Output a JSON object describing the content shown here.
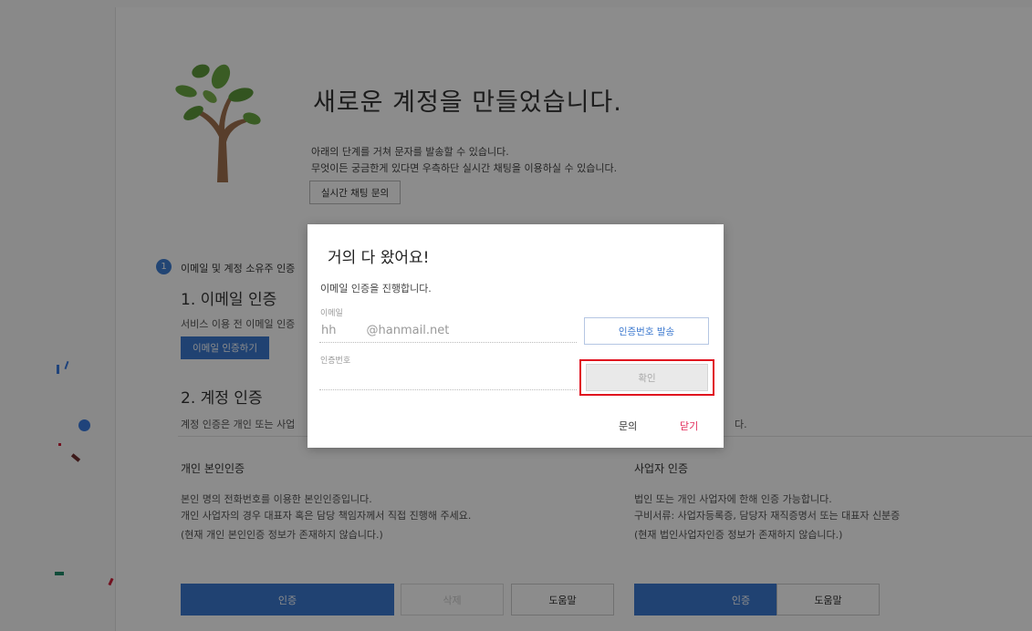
{
  "header": {
    "headline": "새로운 계정을 만들었습니다.",
    "intro_line1": "아래의 단계를 거쳐 문자를 발송할 수 있습니다.",
    "intro_line2": "무엇이든 궁금한게 있다면 우측하단 실시간 채팅을 이용하실 수 있습니다.",
    "chat_button": "실시간 채팅 문의"
  },
  "step": {
    "number": "1",
    "title": "이메일 및 계정 소유주 인증"
  },
  "email_section": {
    "title": "1. 이메일 인증",
    "desc": "서비스 이용 전 이메일 인증",
    "button": "이메일 인증하기"
  },
  "account_section": {
    "title": "2. 계정 인증",
    "desc": "계정 인증은 개인 또는 사업",
    "desc_end": "다."
  },
  "personal": {
    "title": "개인 본인인증",
    "line1": "본인 명의 전화번호를 이용한 본인인증입니다.",
    "line2": "개인 사업자의 경우 대표자 혹은 담당 책임자께서 직접 진행해 주세요.",
    "line3": "(현재 개인 본인인증 정보가 존재하지 않습니다.)",
    "btn_verify": "인증",
    "btn_delete": "삭제",
    "btn_help": "도움말"
  },
  "business": {
    "title": "사업자 인증",
    "line1": "법인 또는 개인 사업자에 한해 인증 가능합니다.",
    "line2": "구비서류: 사업자등록증, 담당자 재직증명서 또는 대표자 신분증",
    "line3": "(현재 법인사업자인증 정보가 존재하지 않습니다.)",
    "btn_verify": "인증",
    "btn_help": "도움말"
  },
  "modal": {
    "title": "거의 다 왔어요!",
    "subtitle": "이메일 인증을 진행합니다.",
    "email_label": "이메일",
    "email_value": "hh        @hanmail.net",
    "send_code_button": "인증번호 발송",
    "code_label": "인증번호",
    "code_value": "",
    "confirm_button": "확인",
    "inquiry_link": "문의",
    "close_link": "닫기"
  },
  "colors": {
    "primary": "#3b78cf",
    "highlight": "#e0101f",
    "close_link": "#e22b5a"
  }
}
